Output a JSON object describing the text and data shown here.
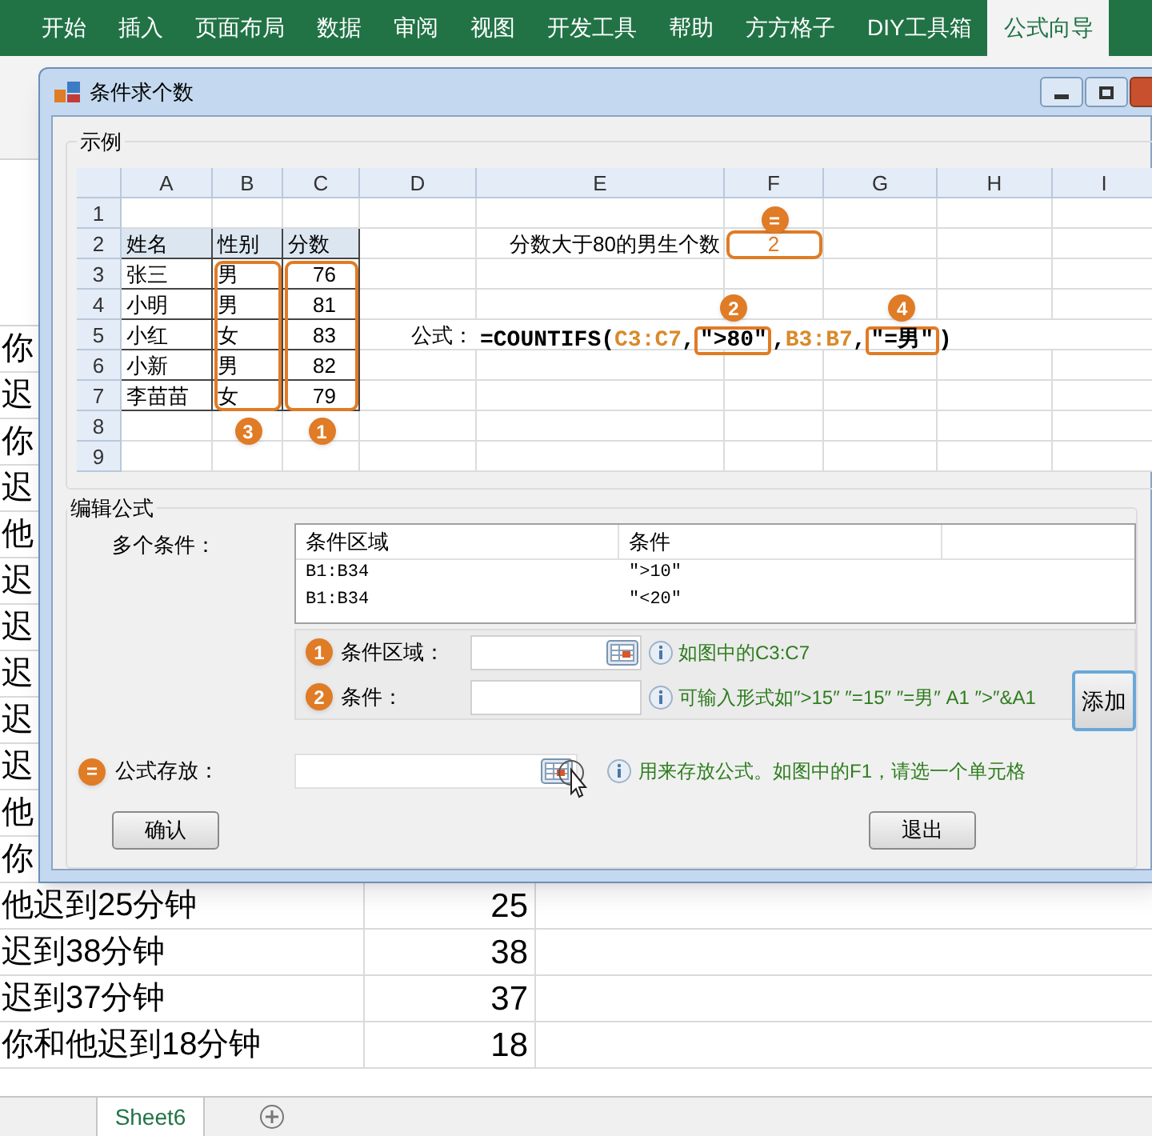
{
  "ribbon": {
    "tabs": [
      {
        "label": "开始",
        "selected": false
      },
      {
        "label": "插入",
        "selected": false
      },
      {
        "label": "页面布局",
        "selected": false
      },
      {
        "label": "数据",
        "selected": false
      },
      {
        "label": "审阅",
        "selected": false
      },
      {
        "label": "视图",
        "selected": false
      },
      {
        "label": "开发工具",
        "selected": false
      },
      {
        "label": "帮助",
        "selected": false
      },
      {
        "label": "方方格子",
        "selected": false
      },
      {
        "label": "DIY工具箱",
        "selected": false
      },
      {
        "label": "公式向导",
        "selected": true
      }
    ]
  },
  "sheet": {
    "rows": [
      {
        "label": "你"
      },
      {
        "label": "迟"
      },
      {
        "label": "你"
      },
      {
        "label": "迟"
      },
      {
        "label": "他"
      },
      {
        "label": "迟"
      },
      {
        "label": "迟"
      },
      {
        "label": "迟"
      },
      {
        "label": "迟"
      },
      {
        "label": "迟"
      },
      {
        "label": "他"
      },
      {
        "label": "你"
      },
      {
        "label": "他迟到25分钟",
        "value": "25"
      },
      {
        "label": "迟到38分钟",
        "value": "38"
      },
      {
        "label": "迟到37分钟",
        "value": "37"
      },
      {
        "label": "你和他迟到18分钟",
        "value": "18"
      }
    ],
    "tabs": [
      {
        "label": "Sheet6",
        "selected": true
      }
    ]
  },
  "dialog": {
    "title": "条件求个数",
    "example": {
      "title": "示例",
      "columns": [
        "A",
        "B",
        "C",
        "D",
        "E",
        "F",
        "G",
        "H",
        "I"
      ],
      "row_numbers": [
        "1",
        "2",
        "3",
        "4",
        "5",
        "6",
        "7",
        "8",
        "9"
      ],
      "table_header": [
        "姓名",
        "性别",
        "分数"
      ],
      "table_rows": [
        [
          "张三",
          "男",
          "76"
        ],
        [
          "小明",
          "男",
          "81"
        ],
        [
          "小红",
          "女",
          "83"
        ],
        [
          "小新",
          "男",
          "82"
        ],
        [
          "李苗苗",
          "女",
          "79"
        ]
      ],
      "range_badges": [
        "3",
        "1"
      ],
      "question": "分数大于80的男生个数",
      "answer": "2",
      "answer_badge": "=",
      "formula_label": "公式：",
      "formula": [
        {
          "kind": "plain",
          "text": "=COUNTIFS("
        },
        {
          "kind": "ref",
          "text": "C3:C7"
        },
        {
          "kind": "plain",
          "text": ","
        },
        {
          "kind": "boxed",
          "text": "″>80″",
          "badge": "2"
        },
        {
          "kind": "plain",
          "text": ","
        },
        {
          "kind": "ref",
          "text": "B3:B7"
        },
        {
          "kind": "plain",
          "text": ","
        },
        {
          "kind": "boxed",
          "text": "″=男″",
          "badge": "4"
        },
        {
          "kind": "plain",
          "text": ")"
        }
      ]
    },
    "edit": {
      "title": "编辑公式",
      "conditions_label": "多个条件：",
      "list_columns": [
        "条件区域",
        "条件"
      ],
      "list_rows": [
        [
          "B1:B34",
          "″>10″"
        ],
        [
          "B1:B34",
          "″<20″"
        ]
      ],
      "range_field": {
        "badge": "1",
        "label": "条件区域：",
        "hint": "如图中的C3:C7"
      },
      "criteria_field": {
        "badge": "2",
        "label": "条件：",
        "hint": "可输入形式如″>15″  ″=15″  ″=男″  A1  ″>″&A1"
      },
      "add_button": "添加",
      "store_field": {
        "badge": "=",
        "label": "公式存放：",
        "hint": "用来存放公式。如图中的F1，请选一个单元格"
      },
      "confirm_button": "确认",
      "exit_button": "退出"
    }
  }
}
